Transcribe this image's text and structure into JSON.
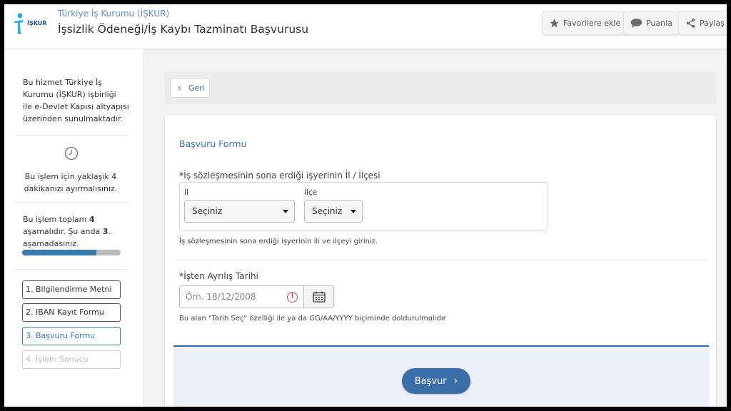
{
  "header": {
    "logo_text": "İŞKUR",
    "institution": "Türkiye İş Kurumu (İŞKUR)",
    "service_title": "İşsizlik Ödeneği/İş Kaybı Tazminatı Başvurusu",
    "buttons": {
      "favorite": "Favorilere ekle",
      "rate": "Puanla",
      "share": "Paylaş"
    },
    "icons": {
      "favorite": "star-icon",
      "rate": "speech-bubble-icon",
      "share": "share-icon"
    }
  },
  "sidebar": {
    "info_lines": [
      "Bu hizmet Türkiye İş",
      "Kurumu (İŞKUR) işbirliği",
      "ile e-Devlet Kapısı altyapısı",
      "üzerinden sunulmaktadır."
    ],
    "time_lines": [
      "Bu işlem için yaklaşık 4",
      "dakikanızı ayırmalısınız."
    ],
    "stage_lines": {
      "l1a": "Bu işlem toplam ",
      "l1b": "4",
      "l2a": "aşamalıdır. Şu anda ",
      "l2b": "3",
      "l2c": ".",
      "l3": "aşamadasınız."
    },
    "progress_fraction": 0.75,
    "steps": [
      {
        "label": "1. Bilgilendirme Metni",
        "state": "done"
      },
      {
        "label": "2. IBAN Kayıt Formu",
        "state": "done"
      },
      {
        "label": "3. Başvuru Formu",
        "state": "active"
      },
      {
        "label": "4. İşlem Sonucu",
        "state": "disabled"
      }
    ]
  },
  "main": {
    "back_label": "Geri",
    "form_title": "Başvuru Formu",
    "location": {
      "required_mark": "*",
      "label": "İş sözleşmesinin sona erdiği işyerinin İl / İlçesi",
      "province_label": "İl",
      "province_value": "Seçiniz",
      "district_label": "İlçe",
      "district_value": "Seçiniz",
      "hint": "İş sözleşmesinin sona erdiği işyerinin ili ve ilçeyi giriniz."
    },
    "date": {
      "required_mark": "*",
      "label": "İşten Ayrılış Tarihi",
      "placeholder": "Örn. 18/12/2008",
      "hint": "Bu alan \"Tarih Seç\" özelliği ile ya da GG/AA/YYYY biçiminde doldurulmalıdır"
    },
    "submit_label": "Başvur"
  },
  "colors": {
    "accent": "#3a78b0",
    "submit": "#3a6ea8",
    "error": "#d04040"
  }
}
